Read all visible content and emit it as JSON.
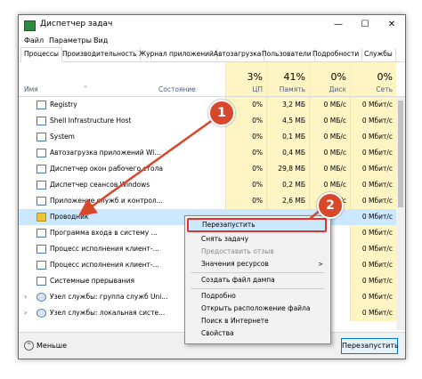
{
  "window": {
    "title": "Диспетчер задач",
    "minimize": "—",
    "maximize": "☐",
    "close": "✕"
  },
  "menu": [
    "Файл",
    "Параметры",
    "Вид"
  ],
  "tabs": [
    "Процессы",
    "Производительность",
    "Журнал приложений",
    "Автозагрузка",
    "Пользователи",
    "Подробности",
    "Службы"
  ],
  "columns": {
    "name": "Имя",
    "status": "Состояние",
    "cpu": {
      "pct": "3%",
      "label": "ЦП"
    },
    "memory": {
      "pct": "41%",
      "label": "Память"
    },
    "disk": {
      "pct": "0%",
      "label": "Диск"
    },
    "network": {
      "pct": "0%",
      "label": "Сеть"
    }
  },
  "rows": [
    {
      "name": "Registry",
      "cpu": "0%",
      "mem": "3,2 МБ",
      "disk": "0 МБ/с",
      "net": "0 Мбит/с",
      "icon": "app-icon"
    },
    {
      "name": "Shell Infrastructure Host",
      "cpu": "0%",
      "mem": "4,5 МБ",
      "disk": "0 МБ/с",
      "net": "0 Мбит/с",
      "icon": "app-icon"
    },
    {
      "name": "System",
      "cpu": "0%",
      "mem": "0,1 МБ",
      "disk": "0 МБ/с",
      "net": "0 Мбит/с",
      "icon": "app-icon"
    },
    {
      "name": "Автозагрузка приложений Wi...",
      "cpu": "0%",
      "mem": "0,4 МБ",
      "disk": "0 МБ/с",
      "net": "0 Мбит/с",
      "icon": "app-icon"
    },
    {
      "name": "Диспетчер окон рабочего стола",
      "cpu": "0%",
      "mem": "29,8 МБ",
      "disk": "0 МБ/с",
      "net": "0 Мбит/с",
      "icon": "app-icon"
    },
    {
      "name": "Диспетчер сеансов Windows",
      "cpu": "0%",
      "mem": "0,2 МБ",
      "disk": "0 МБ/с",
      "net": "0 Мбит/с",
      "icon": "app-icon"
    },
    {
      "name": "Приложение служб и контрол...",
      "cpu": "0%",
      "mem": "2,6 МБ",
      "disk": "0 МБ/с",
      "net": "0 Мбит/с",
      "icon": "app-icon"
    },
    {
      "name": "Проводник",
      "cpu": "",
      "mem": "",
      "disk": "",
      "net": "0 Мбит/с",
      "icon": "folder-icon"
    },
    {
      "name": "Программа входа в систему ...",
      "cpu": "",
      "mem": "",
      "disk": "",
      "net": "0 Мбит/с",
      "icon": "app-icon"
    },
    {
      "name": "Процесс исполнения клиент-...",
      "cpu": "",
      "mem": "",
      "disk": "",
      "net": "0 Мбит/с",
      "icon": "app-icon"
    },
    {
      "name": "Процесс исполнения клиент-...",
      "cpu": "",
      "mem": "",
      "disk": "",
      "net": "0 Мбит/с",
      "icon": "app-icon"
    },
    {
      "name": "Системные прерывания",
      "cpu": "",
      "mem": "",
      "disk": "",
      "net": "0 Мбит/с",
      "icon": "app-icon"
    },
    {
      "name": "Узел службы: группа служб Uni...",
      "cpu": "",
      "mem": "",
      "disk": "",
      "net": "0 Мбит/с",
      "icon": "gear-icon"
    },
    {
      "name": "Узел службы: локальная систе...",
      "cpu": "",
      "mem": "",
      "disk": "",
      "net": "0 Мбит/с",
      "icon": "gear-icon"
    }
  ],
  "context_menu": {
    "restart": "Перезапустить",
    "end_task": "Снять задачу",
    "feedback": "Предоставить отзыв",
    "resource_values": "Значения ресурсов",
    "create_dump": "Создать файл дампа",
    "details": "Подробно",
    "open_location": "Открыть расположение файла",
    "search_online": "Поиск в Интернете",
    "properties": "Свойства"
  },
  "footer": {
    "fewer_details": "Меньше",
    "restart_button": "Перезапустить"
  },
  "callouts": {
    "one": "1",
    "two": "2"
  },
  "colors": {
    "accent": "#d9472b",
    "selection": "#cce8ff",
    "heat": "#fff4c4"
  }
}
